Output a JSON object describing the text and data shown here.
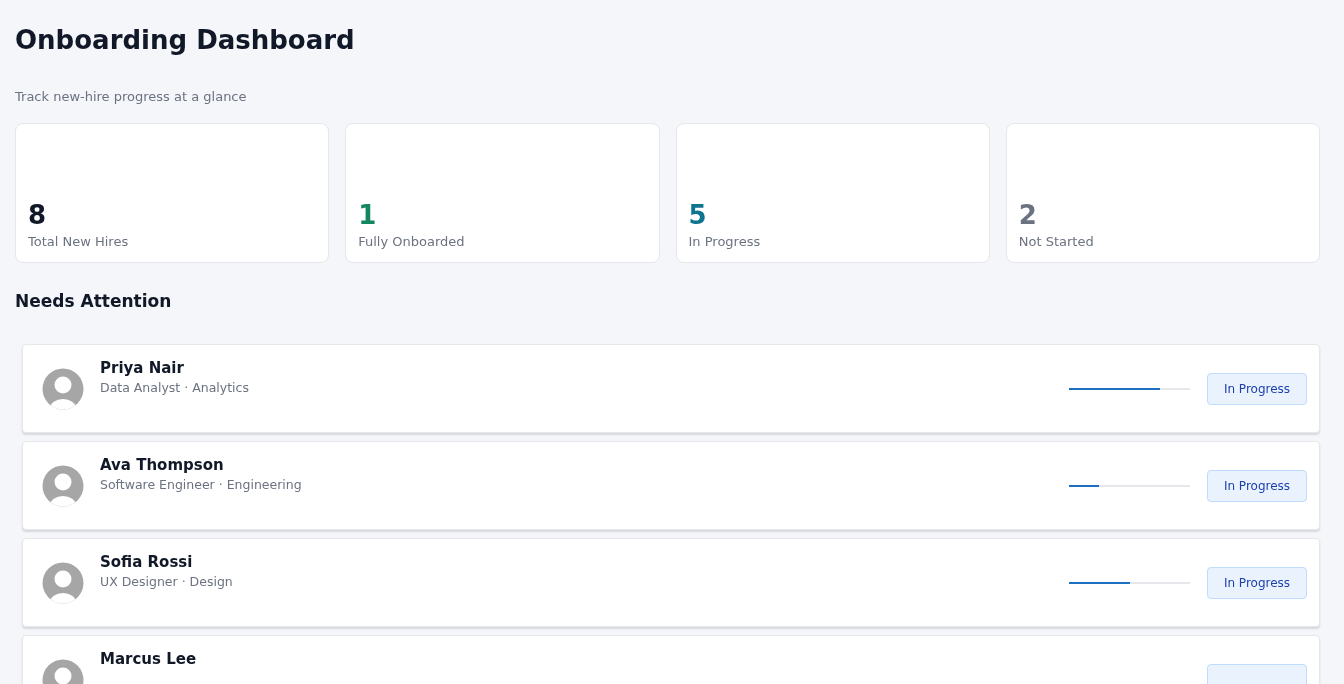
{
  "header": {
    "title": "Onboarding Dashboard",
    "subtitle": "Track new-hire progress at a glance"
  },
  "stats": [
    {
      "value": "8",
      "label": "Total New Hires",
      "color": "#111827"
    },
    {
      "value": "1",
      "label": "Fully Onboarded",
      "color": "#15875f"
    },
    {
      "value": "5",
      "label": "In Progress",
      "color": "#0e7490"
    },
    {
      "value": "2",
      "label": "Not Started",
      "color": "#6b7280"
    }
  ],
  "section_title": "Needs Attention",
  "hires": [
    {
      "name": "Priya Nair",
      "role": "Data Analyst · Analytics",
      "level": 0.75,
      "status": "In Progress"
    },
    {
      "name": "Ava Thompson",
      "role": "Software Engineer · Engineering",
      "level": 0.25,
      "status": "In Progress"
    },
    {
      "name": "Sofia Rossi",
      "role": "UX Designer · Design",
      "level": 0.5,
      "status": "In Progress"
    },
    {
      "name": "Marcus Lee"
    }
  ]
}
